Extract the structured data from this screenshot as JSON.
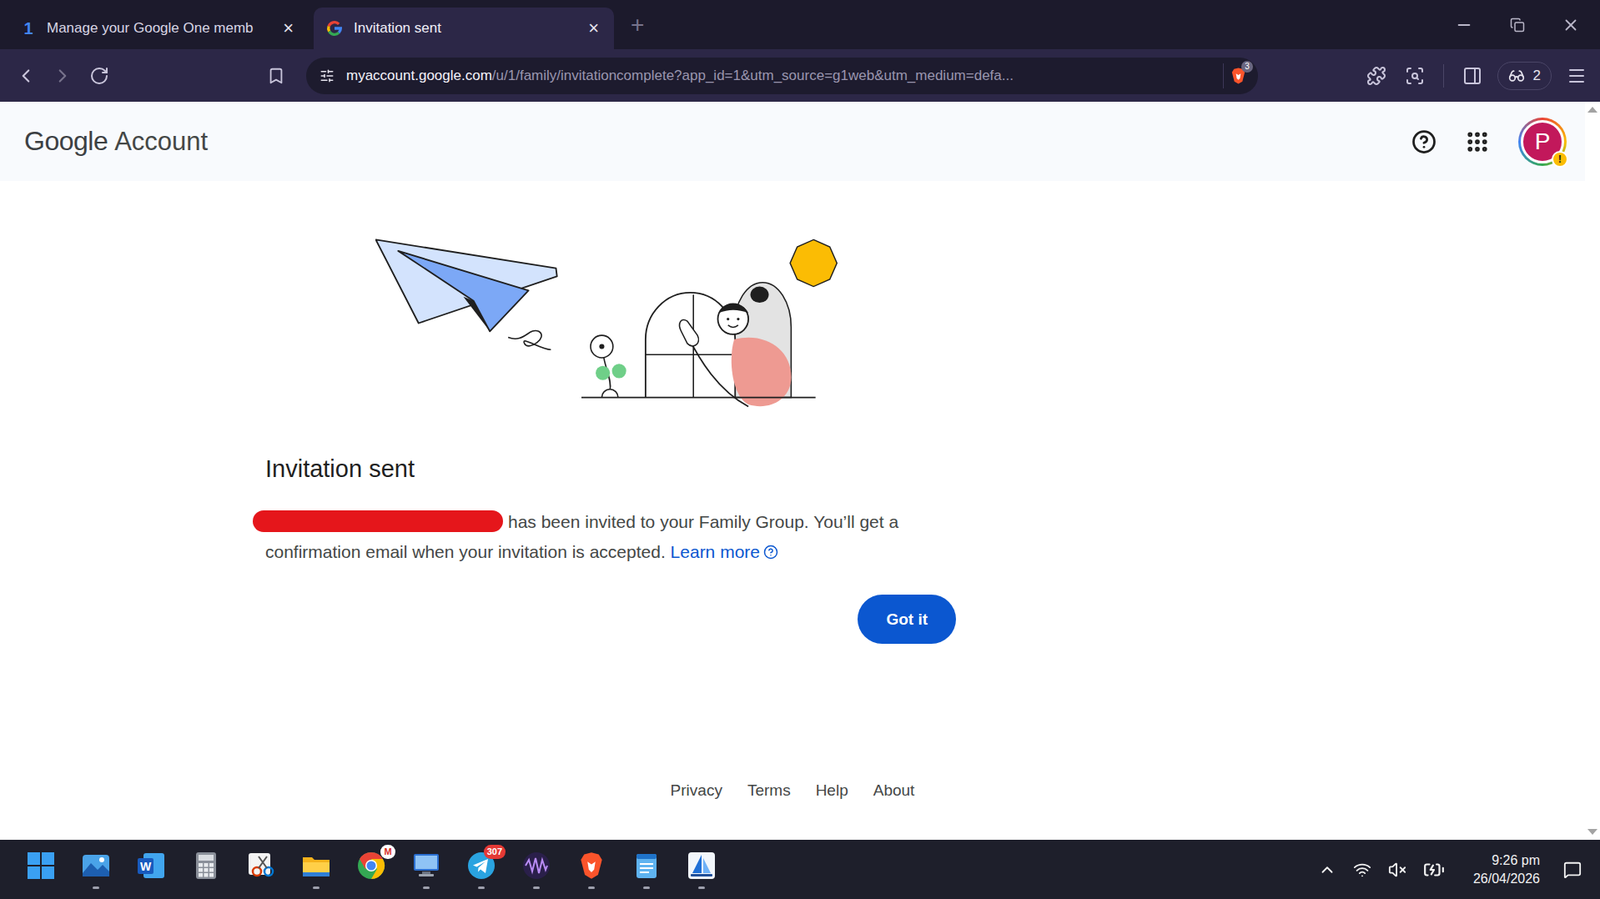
{
  "browser": {
    "tabs": [
      {
        "title": "Manage your Google One memb",
        "kind": "text-favicon",
        "favicon": "1",
        "close": "×",
        "selected": false
      },
      {
        "title": "Invitation sent",
        "kind": "logo-favicon",
        "favicon": "",
        "close": "×",
        "selected": true
      }
    ],
    "new_tab": "+",
    "address": {
      "host": "myaccount.google.com",
      "path": "/u/1/family/invitationcomplete?app_id=1&utm_source=g1web&utm_medium=defa..."
    },
    "shields_badge": "3",
    "wallet_count": "2"
  },
  "header": {
    "brand": "Google",
    "product": "Account",
    "avatar_letter": "P",
    "avatar_badge": "!"
  },
  "invitation": {
    "title": "Invitation sent",
    "invitee_redacted": true,
    "message": "has been invited to your Family Group. You’ll get a confirmation email when your invitation is accepted.",
    "learn_more": "Learn more",
    "button": "Got it"
  },
  "footer": {
    "links": [
      "Privacy",
      "Terms",
      "Help",
      "About"
    ]
  },
  "taskbar": {
    "apps": [
      {
        "kind": "start",
        "running": false
      },
      {
        "kind": "photos",
        "running": true
      },
      {
        "kind": "word",
        "running": false,
        "label": "W"
      },
      {
        "kind": "calculator",
        "running": false
      },
      {
        "kind": "snip",
        "running": false
      },
      {
        "kind": "files",
        "running": true
      },
      {
        "kind": "chrome",
        "running": false,
        "badge": "M"
      },
      {
        "kind": "remote",
        "running": true
      },
      {
        "kind": "telegram",
        "running": true,
        "badge": "307"
      },
      {
        "kind": "waves",
        "running": true
      },
      {
        "kind": "brave",
        "running": true
      },
      {
        "kind": "notepad",
        "running": true
      },
      {
        "kind": "sail",
        "running": true
      }
    ],
    "clock": {
      "time": "9:26 pm",
      "date": "26/04/2026"
    }
  }
}
